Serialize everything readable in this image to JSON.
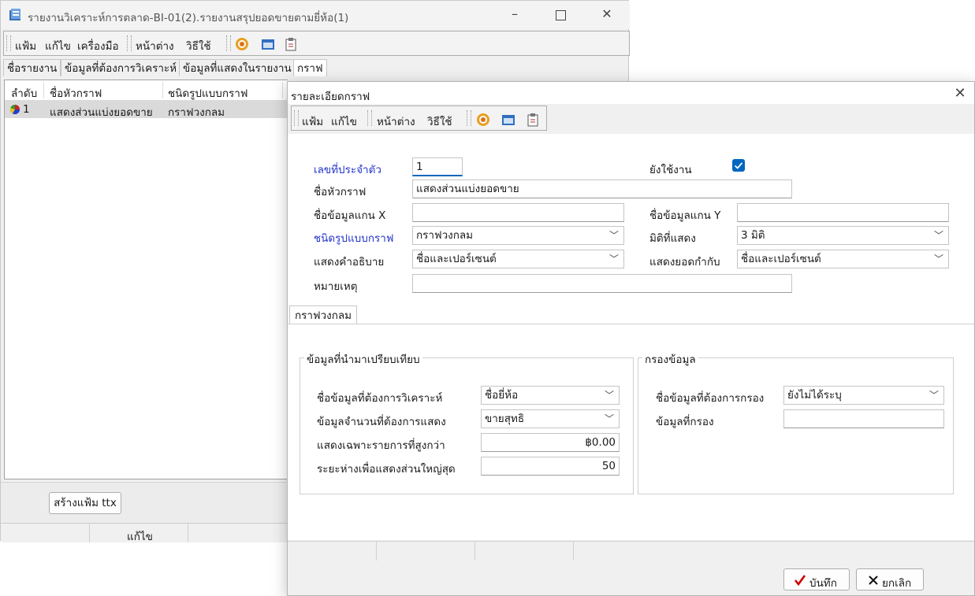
{
  "back_window": {
    "title": "รายงานวิเคราะห์การตลาด-BI-01(2).รายงานสรุปยอดขายตามยี่ห้อ(1)",
    "menu": [
      "แฟ้ม",
      "แก้ไข",
      "เครื่องมือ",
      "หน้าต่าง",
      "วิธีใช้"
    ],
    "tabs": [
      "ชื่อรายงาน",
      "ข้อมูลที่ต้องการวิเคราะห์",
      "ข้อมูลที่แสดงในรายงาน",
      "กราฟ"
    ],
    "grid": {
      "columns": [
        "ลำดับ",
        "ชื่อหัวกราฟ",
        "ชนิดรูปแบบกราฟ"
      ],
      "rows": [
        {
          "no": "1",
          "title": "แสดงส่วนแบ่งยอดขาย",
          "type": "กราฟวงกลม"
        }
      ]
    },
    "create_button": "สร้างแฟ้ม ttx",
    "status_edit": "แก้ไข"
  },
  "dialog": {
    "title": "รายละเอียดกราฟ",
    "menu": [
      "แฟ้ม",
      "แก้ไข",
      "หน้าต่าง",
      "วิธีใช้"
    ],
    "form": {
      "id_label": "เลขที่ประจำตัว",
      "id_value": "1",
      "active_label": "ยังใช้งาน",
      "active_checked": true,
      "title_label": "ชื่อหัวกราฟ",
      "title_value": "แสดงส่วนแบ่งยอดขาย",
      "x_label": "ชื่อข้อมูลแกน X",
      "x_value": "",
      "y_label": "ชื่อข้อมูลแกน Y",
      "y_value": "",
      "type_label": "ชนิดรูปแบบกราฟ",
      "type_value": "กราฟวงกลม",
      "dim_label": "มิติที่แสดง",
      "dim_value": "3 มิติ",
      "desc_label": "แสดงคำอธิบาย",
      "desc_value": "ชื่อและเปอร์เซนต์",
      "total_label": "แสดงยอดกำกับ",
      "total_value": "ชื่อและเปอร์เซนต์",
      "note_label": "หมายเหตุ",
      "note_value": ""
    },
    "tab": "กราฟวงกลม",
    "compare_group": {
      "title": "ข้อมูลที่นำมาเปรียบเทียบ",
      "analyze_label": "ชื่อข้อมูลที่ต้องการวิเคราะห์",
      "analyze_value": "ชื่อยี่ห้อ",
      "amount_label": "ข้อมูลจำนวนที่ต้องการแสดง",
      "amount_value": "ขายสุทธิ",
      "above_label": "แสดงเฉพาะรายการที่สูงกว่า",
      "above_value": "฿0.00",
      "gap_label": "ระยะห่างเพื่อแสดงส่วนใหญ่สุด",
      "gap_value": "50"
    },
    "filter_group": {
      "title": "กรองข้อมูล",
      "filter_field_label": "ชื่อข้อมูลที่ต้องการกรอง",
      "filter_field_value": "ยังไม่ได้ระบุ",
      "filter_value_label": "ข้อมูลที่กรอง",
      "filter_value_value": ""
    },
    "save_button": "บันทึก",
    "cancel_button": "ยกเลิก"
  },
  "colors": {
    "accent_blue": "#0067c0",
    "label_blue": "#2233cc",
    "save_check": "#cc0000"
  }
}
